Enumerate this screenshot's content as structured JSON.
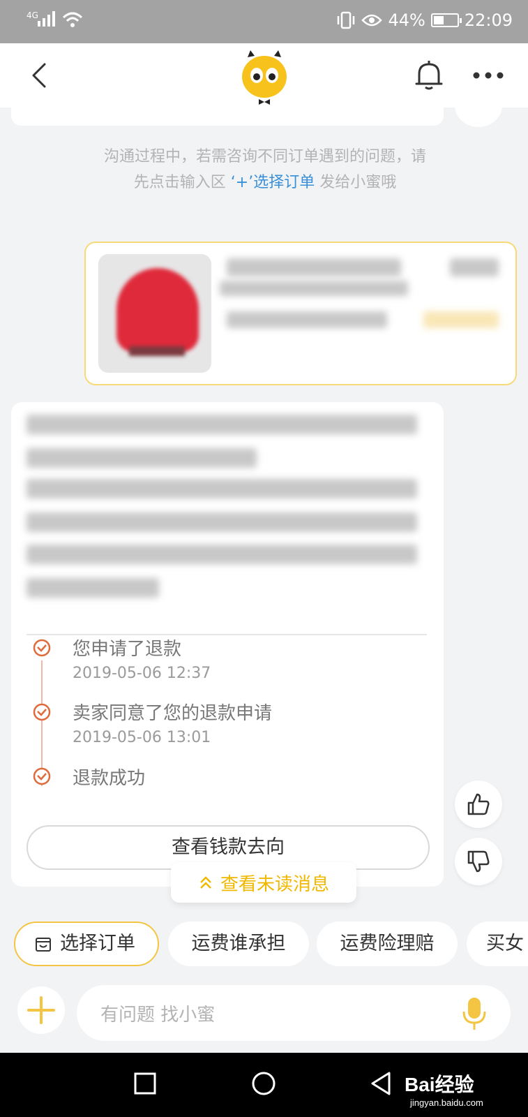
{
  "status_bar": {
    "network": "4G",
    "battery_percent": "44%",
    "time": "22:09",
    "battery_level": 0.44,
    "icons": [
      "signal-icon",
      "wifi-icon",
      "vibrate-icon",
      "eye-icon",
      "battery-icon"
    ]
  },
  "nav": {
    "icons": [
      "back-icon",
      "mascot-logo",
      "bell-icon",
      "more-icon"
    ]
  },
  "system_message": {
    "part1": "沟通过程中，若需咨询不同订单遇到的问题，请先点击输入区",
    "plus": "‘+’",
    "link": "选择订单",
    "part2": "发给小蜜哦"
  },
  "timeline": [
    {
      "title": "您申请了退款",
      "time": "2019-05-06 12:37"
    },
    {
      "title": "卖家同意了您的退款申请",
      "time": "2019-05-06 13:01"
    },
    {
      "title": "退款成功",
      "time": ""
    }
  ],
  "money_button": "查看钱款去向",
  "unread_button": "查看未读消息",
  "quick_chips": [
    {
      "label": "选择订单",
      "selected": true
    },
    {
      "label": "运费谁承担",
      "selected": false
    },
    {
      "label": "运费险理赔",
      "selected": false
    },
    {
      "label": "买女",
      "selected": false
    }
  ],
  "input": {
    "placeholder": "有问题 找小蜜"
  },
  "watermark": {
    "brand": "Bai经验",
    "url": "jingyan.baidu.com"
  },
  "colors": {
    "accent": "#f4c542",
    "link": "#3a90d8",
    "timeline": "#e06a3a"
  }
}
